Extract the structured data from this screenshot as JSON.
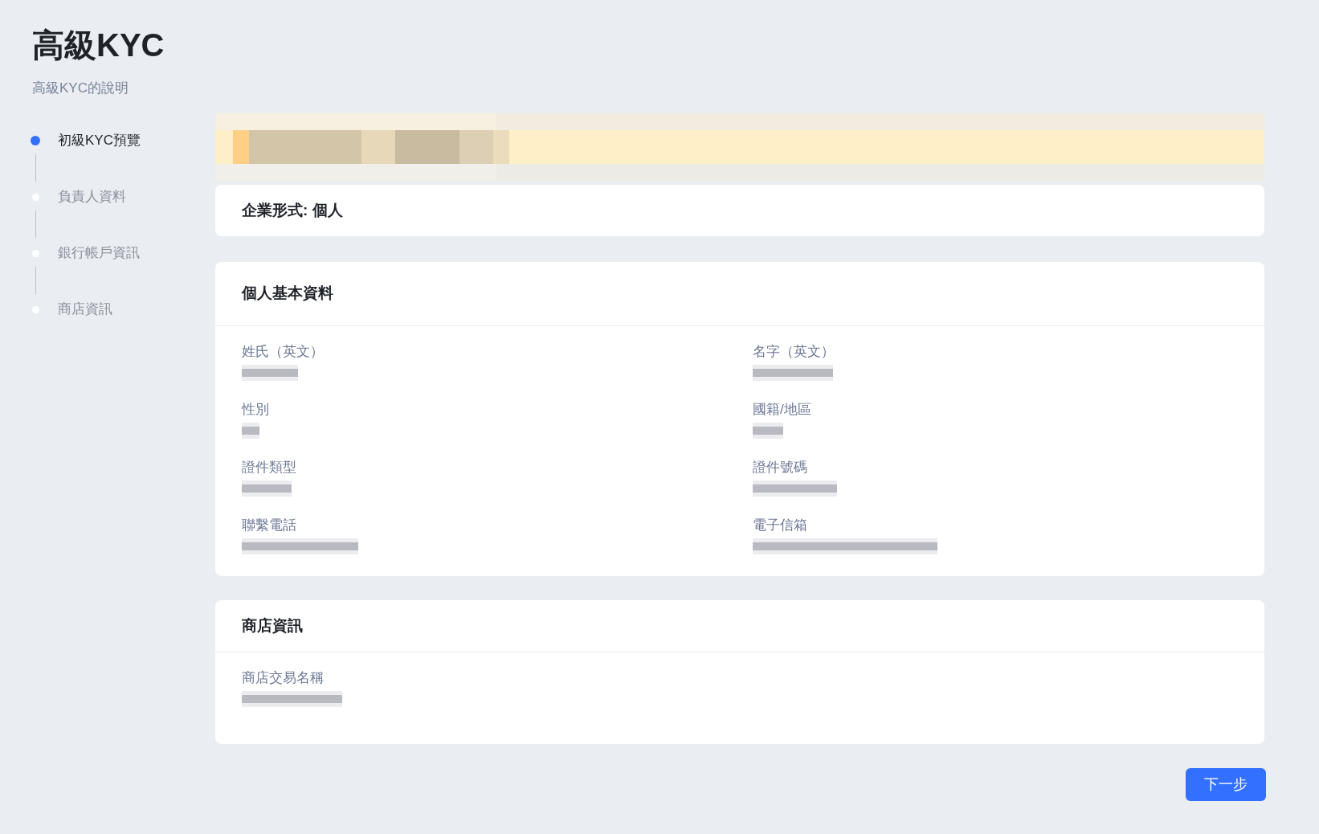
{
  "page": {
    "title": "高級KYC",
    "description": "高級KYC的說明"
  },
  "steps": [
    {
      "label": "初級KYC預覽",
      "selected": true
    },
    {
      "label": "負責人資料",
      "selected": false
    },
    {
      "label": "銀行帳戶資訊",
      "selected": false
    },
    {
      "label": "商店資訊",
      "selected": false
    }
  ],
  "banner": {
    "redacted": true
  },
  "company_type": {
    "text": "企業形式: 個人"
  },
  "sections": [
    {
      "title": "個人基本資料",
      "fields": [
        {
          "label": "姓氏（英文）",
          "redacted": true
        },
        {
          "label": "名字（英文）",
          "redacted": true
        },
        {
          "label": "性別",
          "redacted": true
        },
        {
          "label": "國籍/地區",
          "redacted": true
        },
        {
          "label": "證件類型",
          "redacted": true
        },
        {
          "label": "證件號碼",
          "redacted": true
        },
        {
          "label": "聯繫電話",
          "redacted": true
        },
        {
          "label": "電子信箱",
          "redacted": true
        }
      ]
    },
    {
      "title": "商店資訊",
      "fields": [
        {
          "label": "商店交易名稱",
          "redacted": true
        }
      ]
    }
  ],
  "next_button": {
    "label": "下一步"
  }
}
